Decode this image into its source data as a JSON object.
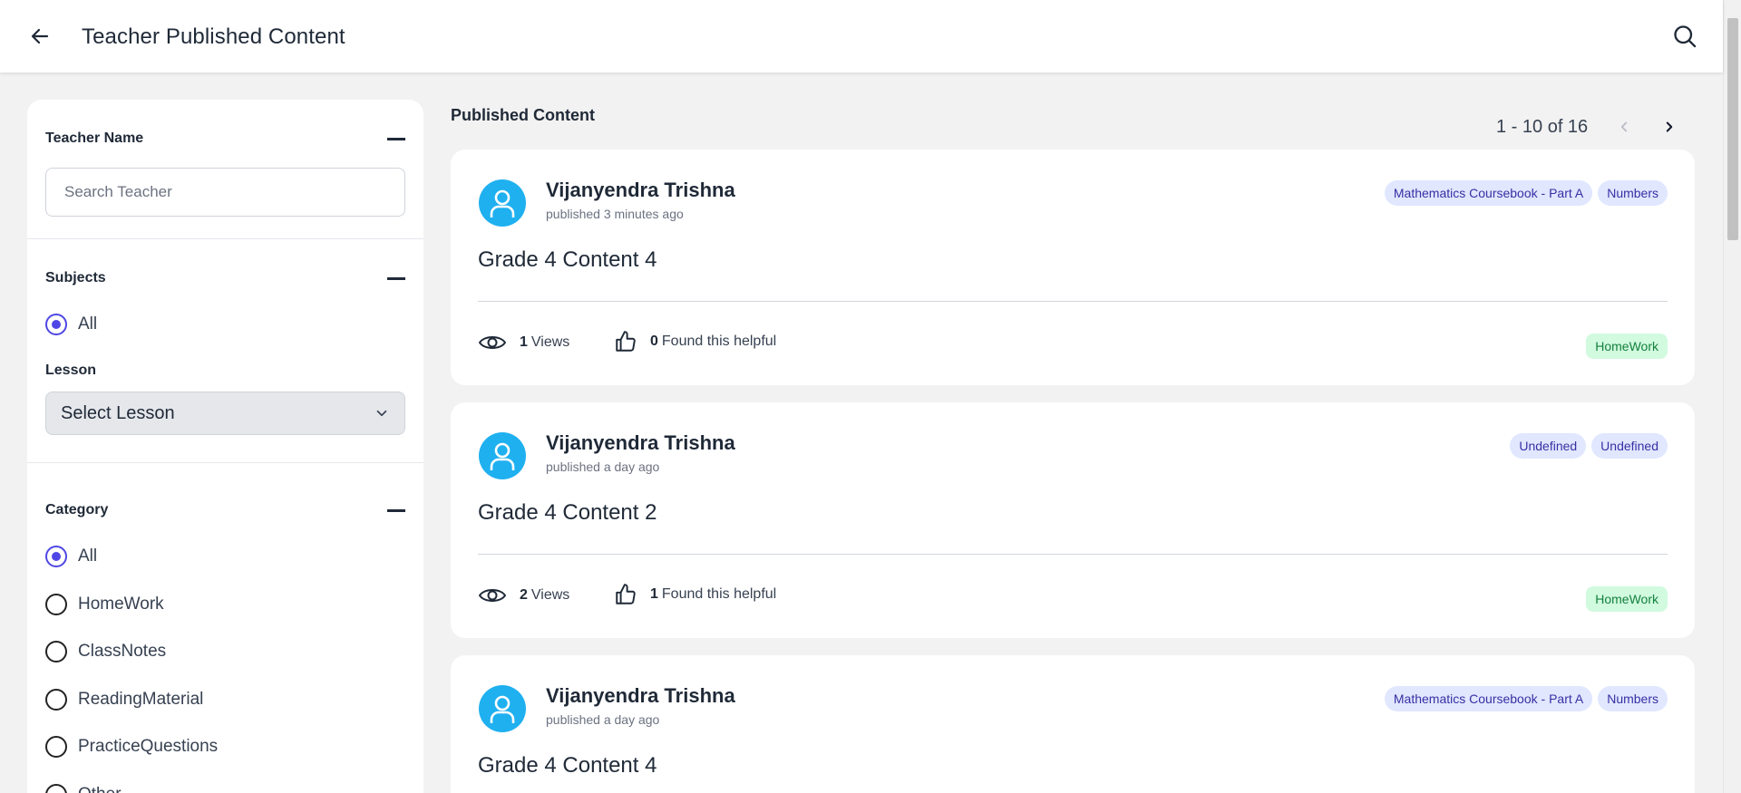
{
  "header": {
    "title": "Teacher Published Content"
  },
  "sidebar": {
    "teacher_name": {
      "title": "Teacher Name",
      "search_placeholder": "Search Teacher"
    },
    "subjects": {
      "title": "Subjects",
      "options": [
        {
          "label": "All",
          "checked": true
        }
      ],
      "lesson_label": "Lesson",
      "lesson_select_value": "Select Lesson"
    },
    "category": {
      "title": "Category",
      "options": [
        {
          "label": "All",
          "checked": true
        },
        {
          "label": "HomeWork",
          "checked": false
        },
        {
          "label": "ClassNotes",
          "checked": false
        },
        {
          "label": "ReadingMaterial",
          "checked": false
        },
        {
          "label": "PracticeQuestions",
          "checked": false
        },
        {
          "label": "Other",
          "checked": false
        }
      ]
    }
  },
  "main": {
    "heading": "Published Content",
    "pagination": "1 - 10 of 16",
    "cards": [
      {
        "author": "Vijanyendra Trishna",
        "published": "published 3 minutes ago",
        "tags": [
          "Mathematics Coursebook - Part A",
          "Numbers"
        ],
        "title": "Grade 4 Content 4",
        "views": "1",
        "views_label": "Views",
        "helpful": "0",
        "helpful_label": "Found this helpful",
        "category": "HomeWork"
      },
      {
        "author": "Vijanyendra Trishna",
        "published": "published a day ago",
        "tags": [
          "Undefined",
          "Undefined"
        ],
        "title": "Grade 4 Content 2",
        "views": "2",
        "views_label": "Views",
        "helpful": "1",
        "helpful_label": "Found this helpful",
        "category": "HomeWork"
      },
      {
        "author": "Vijanyendra Trishna",
        "published": "published a day ago",
        "tags": [
          "Mathematics Coursebook - Part A",
          "Numbers"
        ],
        "title": "Grade 4 Content 4"
      }
    ]
  },
  "colors": {
    "accent": "#4f46e5",
    "avatar": "#1fb0f0",
    "tag_bg": "#e0e7ff",
    "badge_bg": "#d1fadf"
  },
  "icons": {
    "back": "arrow-left-icon",
    "search": "search-icon",
    "views": "eye-icon",
    "helpful": "thumbs-up-icon",
    "collapse": "minus-icon",
    "select": "chevron-down-icon",
    "pager_prev": "chevron-left-icon",
    "pager_next": "chevron-right-icon",
    "avatar": "user-icon"
  }
}
